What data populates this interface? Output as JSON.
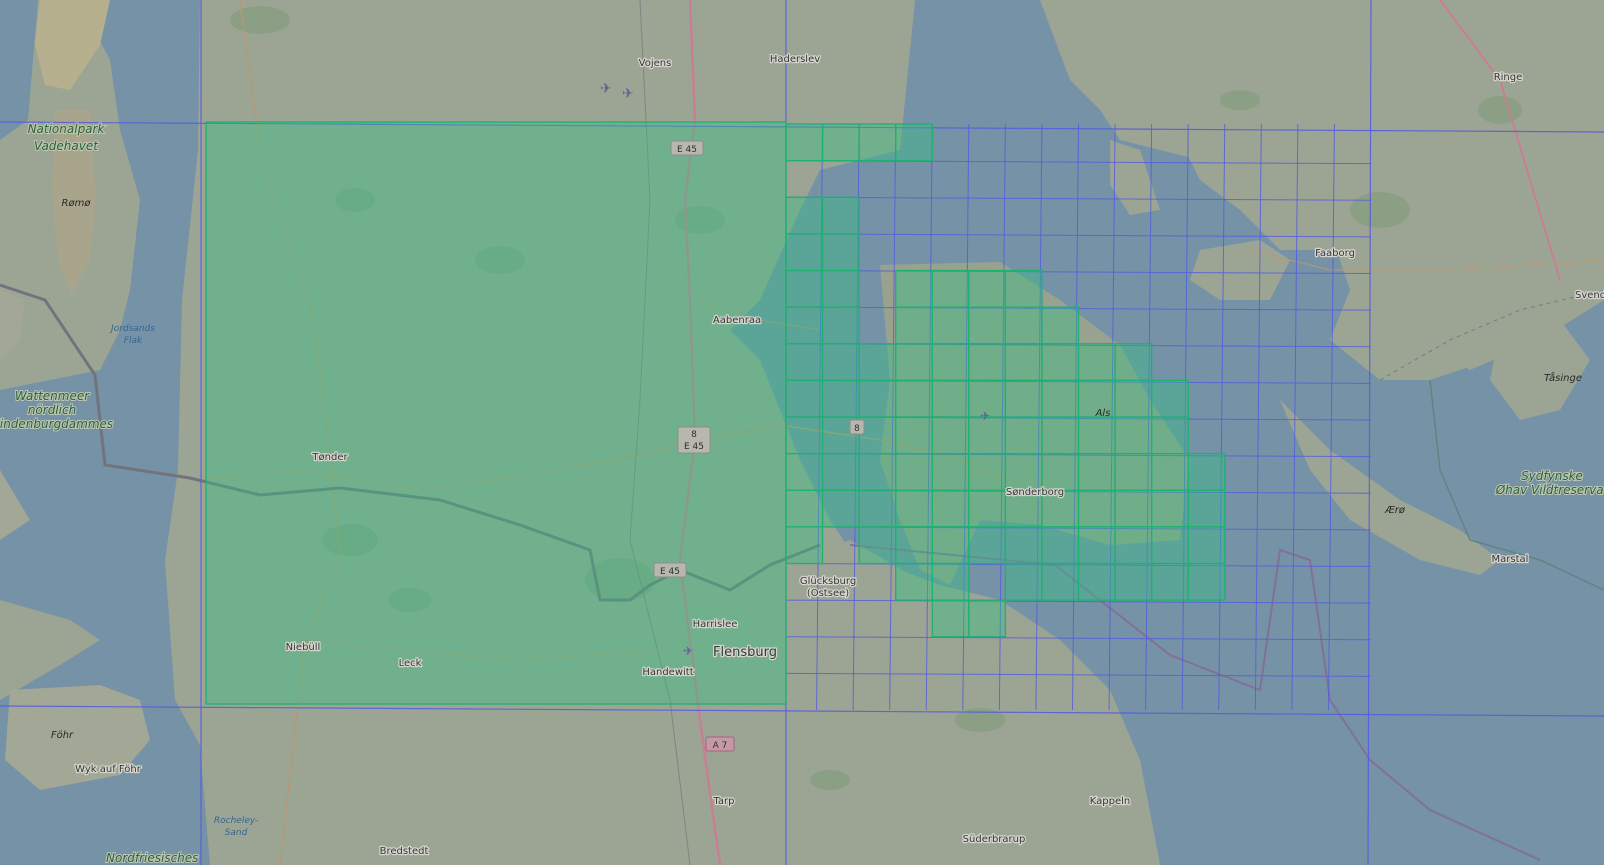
{
  "colors": {
    "sea": "#7f9fb6",
    "land": "#aab4a1",
    "forest": "#8fa98a",
    "coverage_fill": "#3ccf8e",
    "coverage_stroke": "#22c07a",
    "tile_grid": "#5e66f0",
    "border": "#7d7d86",
    "road_primary": "#c9a57a",
    "motorway": "#d98aa0"
  },
  "places": [
    {
      "id": "vojens",
      "label": "Vojens"
    },
    {
      "id": "haderslev",
      "label": "Haderslev"
    },
    {
      "id": "ringe",
      "label": "Ringe"
    },
    {
      "id": "romo",
      "label": "Rømø"
    },
    {
      "id": "faaborg",
      "label": "Faaborg"
    },
    {
      "id": "svendborg",
      "label": "Svend"
    },
    {
      "id": "aabenraa",
      "label": "Aabenraa"
    },
    {
      "id": "tasinge",
      "label": "Tåsinge"
    },
    {
      "id": "als",
      "label": "Als"
    },
    {
      "id": "tonder",
      "label": "Tønder"
    },
    {
      "id": "sonderborg",
      "label": "Sønderborg"
    },
    {
      "id": "aero",
      "label": "Ærø"
    },
    {
      "id": "marstal",
      "label": "Marstal"
    },
    {
      "id": "glucksburg",
      "label": "Glücksburg"
    },
    {
      "id": "glucksburg2",
      "label": "(Ostsee)"
    },
    {
      "id": "harrislee",
      "label": "Harrislee"
    },
    {
      "id": "flensburg",
      "label": "Flensburg"
    },
    {
      "id": "niebull",
      "label": "Niebüll"
    },
    {
      "id": "leck",
      "label": "Leck"
    },
    {
      "id": "handewitt",
      "label": "Handewitt"
    },
    {
      "id": "fohr",
      "label": "Föhr"
    },
    {
      "id": "wyk",
      "label": "Wyk auf Föhr"
    },
    {
      "id": "tarp",
      "label": "Tarp"
    },
    {
      "id": "kappeln",
      "label": "Kappeln"
    },
    {
      "id": "bredstedt",
      "label": "Bredstedt"
    },
    {
      "id": "suderbrarup",
      "label": "Süderbrarup"
    }
  ],
  "areas": [
    {
      "id": "nationalpark",
      "lines": [
        "Nationalpark",
        "Vadehavet"
      ]
    },
    {
      "id": "wattenmeer",
      "lines": [
        "Wattenmeer",
        "nördlich",
        "Hindenburgdammes"
      ]
    },
    {
      "id": "sydfynske",
      "lines": [
        "Sydfynske",
        "Øhav Vildtreservat"
      ]
    },
    {
      "id": "nordfriesisches",
      "lines": [
        "Nordfriesisches"
      ]
    }
  ],
  "water_labels": [
    {
      "id": "jordsands",
      "lines": [
        "Jordsands",
        "Flak"
      ]
    },
    {
      "id": "rocheley",
      "lines": [
        "Rocheley-",
        "Sand"
      ]
    }
  ],
  "road_shields": [
    {
      "id": "e45-north",
      "label": "E 45"
    },
    {
      "id": "e45-mid-8",
      "label": "8"
    },
    {
      "id": "e45-mid",
      "label": "E 45"
    },
    {
      "id": "e45-south",
      "label": "E 45"
    },
    {
      "id": "road-8-east",
      "label": "8"
    },
    {
      "id": "a7",
      "label": "A 7"
    }
  ]
}
